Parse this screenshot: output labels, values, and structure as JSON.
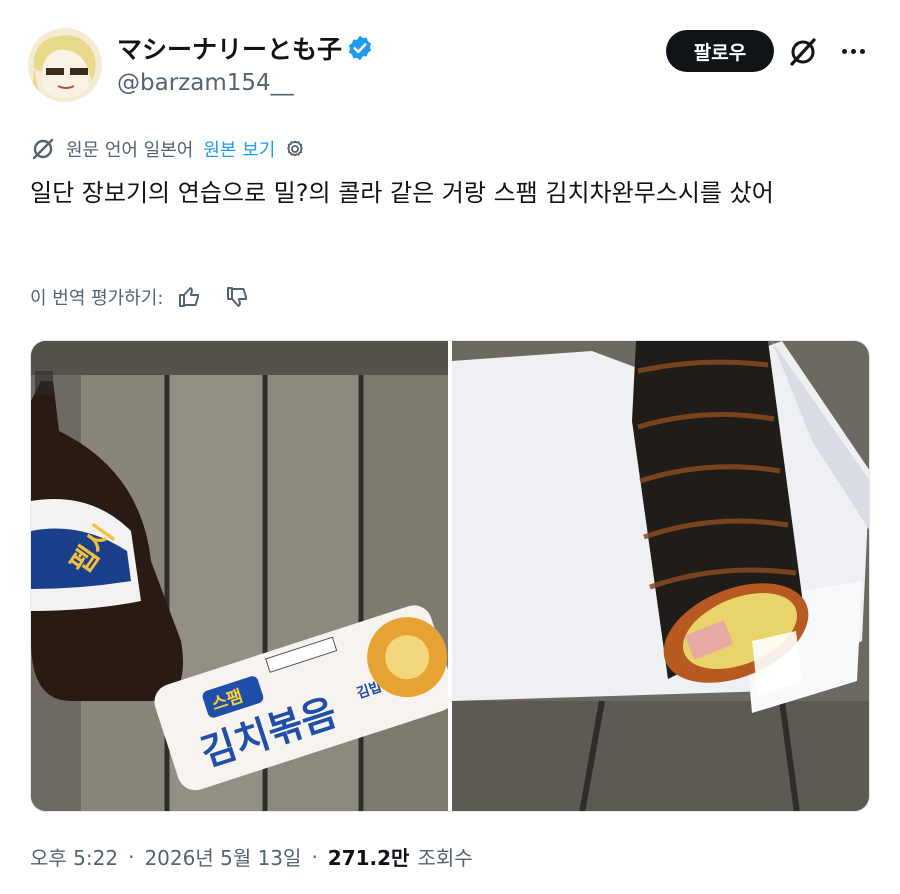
{
  "author": {
    "display_name": "マシーナリーとも子",
    "handle": "@barzam154__",
    "verified": true
  },
  "actions": {
    "follow_label": "팔로우",
    "grok_icon": "grok-icon",
    "more_icon": "more-icon"
  },
  "translation": {
    "source_language": "원문 언어 일본어",
    "show_original": "원본 보기"
  },
  "tweet": {
    "text": "일단 장보기의 연습으로 밀?의 콜라 같은 거랑 스팸 김치차완무스시를 샀어"
  },
  "rate": {
    "label": "이 번역 평가하기:"
  },
  "media": {
    "photos": [
      {
        "description": "콜라 병과 스팸 김치볶음김밥 포장",
        "bottle_label": "펩시",
        "package_brand": "스팸",
        "package_title": "김치볶음",
        "package_suffix": "김밥"
      },
      {
        "description": "포장을 벗긴 김밥"
      }
    ]
  },
  "meta": {
    "time": "오후 5:22",
    "date": "2026년 5월 13일",
    "views_count": "271.2만",
    "views_label": "조회수",
    "separator": "·"
  },
  "colors": {
    "text_primary": "#0f1419",
    "text_secondary": "#536471",
    "link": "#1d9bf0",
    "verified": "#1d9bf0",
    "follow_bg": "#0f1419"
  }
}
